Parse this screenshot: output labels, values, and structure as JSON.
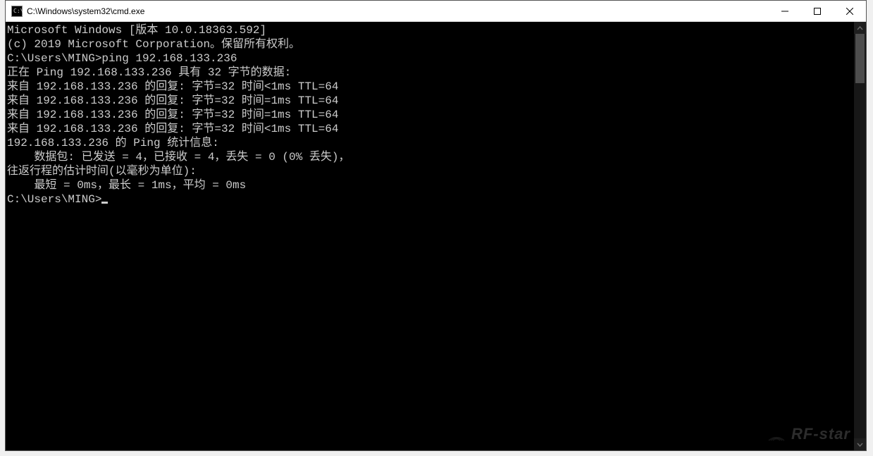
{
  "window": {
    "title": "C:\\Windows\\system32\\cmd.exe"
  },
  "terminal": {
    "lines": [
      "Microsoft Windows [版本 10.0.18363.592]",
      "(c) 2019 Microsoft Corporation。保留所有权利。",
      "",
      "C:\\Users\\MING>ping 192.168.133.236",
      "",
      "正在 Ping 192.168.133.236 具有 32 字节的数据:",
      "来自 192.168.133.236 的回复: 字节=32 时间<1ms TTL=64",
      "来自 192.168.133.236 的回复: 字节=32 时间=1ms TTL=64",
      "来自 192.168.133.236 的回复: 字节=32 时间=1ms TTL=64",
      "来自 192.168.133.236 的回复: 字节=32 时间<1ms TTL=64",
      "",
      "192.168.133.236 的 Ping 统计信息:",
      "    数据包: 已发送 = 4，已接收 = 4，丢失 = 0 (0% 丢失)，",
      "往返行程的估计时间(以毫秒为单位):",
      "    最短 = 0ms，最长 = 1ms，平均 = 0ms",
      "",
      "C:\\Users\\MING>"
    ]
  },
  "watermark": {
    "text": "RF-star"
  }
}
